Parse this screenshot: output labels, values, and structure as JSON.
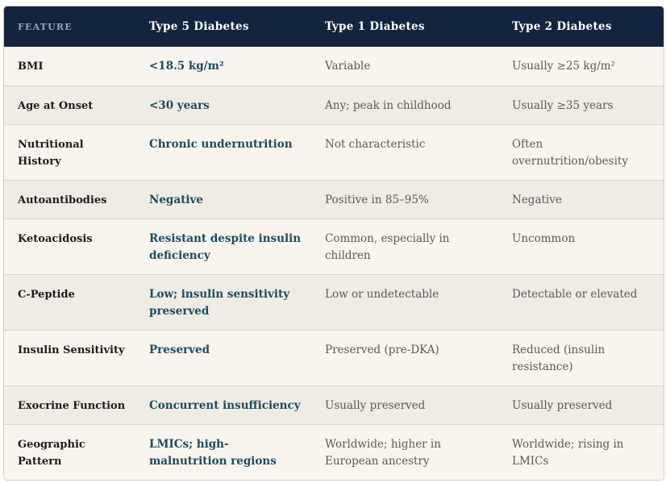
{
  "header": {
    "feature": "FEATURE",
    "type5": "Type 5 Diabetes",
    "type1": "Type 1 Diabetes",
    "type2": "Type 2 Diabetes"
  },
  "rows": [
    {
      "feature": "BMI",
      "type5": "<18.5 kg/m²",
      "type1": "Variable",
      "type2": "Usually ≥25 kg/m²"
    },
    {
      "feature": "Age at Onset",
      "type5": "<30 years",
      "type1": "Any; peak in childhood",
      "type2": "Usually ≥35 years"
    },
    {
      "feature": "Nutritional History",
      "type5": "Chronic undernutrition",
      "type1": "Not characteristic",
      "type2": "Often overnutrition/obesity"
    },
    {
      "feature": "Autoantibodies",
      "type5": "Negative",
      "type1": "Positive in 85–95%",
      "type2": "Negative"
    },
    {
      "feature": "Ketoacidosis",
      "type5": "Resistant despite insulin deficiency",
      "type1": "Common, especially in children",
      "type2": "Uncommon"
    },
    {
      "feature": "C-Peptide",
      "type5": "Low; insulin sensitivity preserved",
      "type1": "Low or undetectable",
      "type2": "Detectable or elevated"
    },
    {
      "feature": "Insulin Sensitivity",
      "type5": "Preserved",
      "type1": "Preserved (pre-DKA)",
      "type2": "Reduced (insulin resistance)"
    },
    {
      "feature": "Exocrine Function",
      "type5": "Concurrent insufficiency",
      "type1": "Usually preserved",
      "type2": "Usually preserved"
    },
    {
      "feature": "Geographic Pattern",
      "type5": "LMICs; high-malnutrition regions",
      "type1": "Worldwide; higher in European ancestry",
      "type2": "Worldwide; rising in LMICs"
    }
  ]
}
